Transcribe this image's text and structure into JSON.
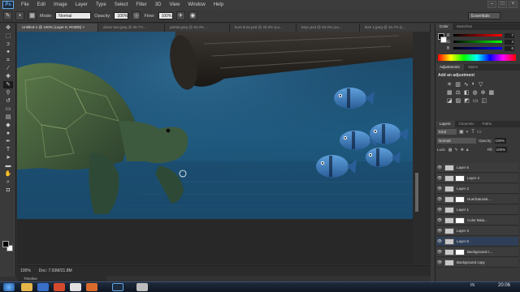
{
  "app": {
    "logo_text": "Ps",
    "menu": [
      "File",
      "Edit",
      "Image",
      "Layer",
      "Type",
      "Select",
      "Filter",
      "3D",
      "View",
      "Window",
      "Help"
    ]
  },
  "options_bar": {
    "mode_label": "Mode:",
    "mode_value": "Normal",
    "opacity_label": "Opacity:",
    "opacity_value": "100%",
    "flow_label": "Flow:",
    "flow_value": "100%",
    "workspace": "Essentials"
  },
  "tabs": [
    "Untitled-1 @ 100% (Layer 6, RGB/8) ×",
    "dasar laut.jpeg @ 66.7% ...",
    "pantai.jpeg @ 33.3% ...",
    "kura kura.psd @ 33.3% (La...",
    "kayu.psd @ 33.3% (La...",
    "ikan 1.jpeg @ 16.7% (L..."
  ],
  "status": {
    "zoom": "100%",
    "doc": "Doc: 7.03M/21.8M",
    "timeline": "Timeline"
  },
  "color_panel": {
    "tabs": [
      "Color",
      "Swatches"
    ],
    "r": "7",
    "g": "4",
    "b": "6"
  },
  "adjustments_panel": {
    "tabs": [
      "Adjustments",
      "Styles"
    ],
    "title": "Add an adjustment"
  },
  "layers_panel": {
    "tabs": [
      "Layers",
      "Channels",
      "Paths"
    ],
    "kind": "Kind",
    "blend_mode": "Normal",
    "opacity_label": "Opacity:",
    "opacity_value": "100%",
    "lock_label": "Lock:",
    "fill_label": "Fill:",
    "fill_value": "100%",
    "layers": [
      {
        "name": "Layer 5",
        "mask": false,
        "active": false
      },
      {
        "name": "Layer 4",
        "mask": true,
        "active": false
      },
      {
        "name": "Layer 2",
        "mask": false,
        "active": false
      },
      {
        "name": "Hue/Saturati...",
        "mask": true,
        "active": false
      },
      {
        "name": "Layer 1",
        "mask": false,
        "active": false
      },
      {
        "name": "Color Bala...",
        "mask": true,
        "active": false
      },
      {
        "name": "Layer 3",
        "mask": false,
        "active": false
      },
      {
        "name": "Layer 6",
        "mask": false,
        "active": true
      },
      {
        "name": "Background c...",
        "mask": true,
        "active": false
      },
      {
        "name": "Background copy",
        "mask": false,
        "active": false
      }
    ]
  },
  "taskbar": {
    "clock": "20:06",
    "lang": "IN"
  },
  "colors": {
    "accent": "#5fa8e8",
    "water_top": "#1c4868",
    "water_mid": "#1e5a80",
    "fish": "#3b7fc4"
  }
}
